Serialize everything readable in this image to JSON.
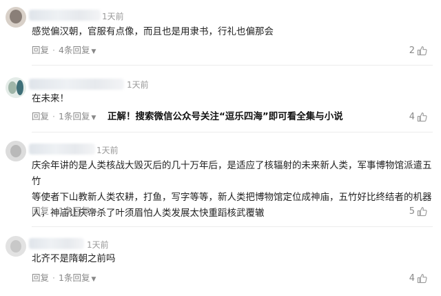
{
  "comments": [
    {
      "time": "1天前",
      "text": "感觉偏汉朝，官服有点像，而且也是用隶书，行礼也偏那会",
      "reply_label": "回复",
      "replies_label": "4条回复",
      "likes": "2"
    },
    {
      "time": "1天前",
      "text": "在未来！",
      "reply_label": "回复",
      "replies_label": "1条回复",
      "promo": "正解！搜索微信公众号关注“逗乐四海”即可看全集与小说",
      "likes": "4"
    },
    {
      "time": "1天前",
      "text_lines": [
        "庆余年讲的是人类核战大毁灭后的几十万年后，是适应了核辐射的未来新人类，军事博物馆派遣五竹",
        "等使者下山教新人类农耕，打鱼，写字等等，新人类把博物馆定位成神庙，五竹好比终结者的机器",
        "人，神庙让庆帝杀了叶须眉怕人类发展太快重蹈核武覆辙"
      ],
      "reply_label": "回复",
      "replies_label": "1条回复",
      "likes": "5"
    },
    {
      "time": "1天前",
      "text": "北齐不是隋朝之前吗",
      "reply_label": "回复",
      "replies_label": "1条回复",
      "likes": "4"
    }
  ],
  "icons": {
    "like": "thumbs-up-icon",
    "more": "chevron-down-icon"
  },
  "colors": {
    "text": "#222222",
    "meta": "#888888",
    "time": "#999999"
  }
}
